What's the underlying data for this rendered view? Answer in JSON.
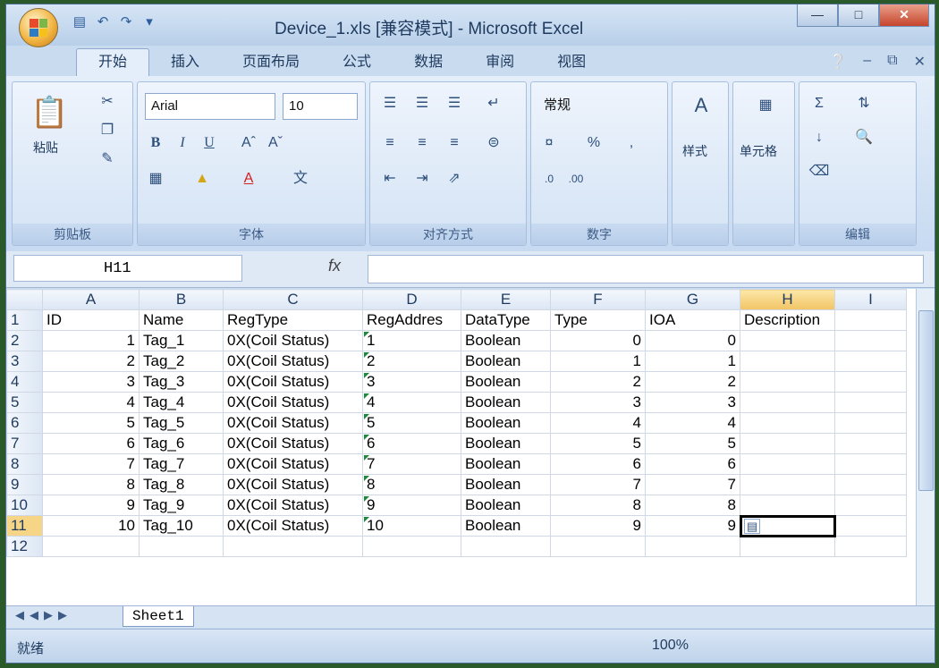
{
  "window": {
    "title": "Device_1.xls  [兼容模式] - Microsoft Excel"
  },
  "tabs": [
    "开始",
    "插入",
    "页面布局",
    "公式",
    "数据",
    "审阅",
    "视图"
  ],
  "ribbon": {
    "clipboard": {
      "label": "剪贴板",
      "paste": "粘贴"
    },
    "font": {
      "label": "字体",
      "name": "Arial",
      "size": "10"
    },
    "alignment": {
      "label": "对齐方式"
    },
    "number": {
      "label": "数字",
      "format": "常规"
    },
    "styles": {
      "label": "样式"
    },
    "cells": {
      "label": "单元格"
    },
    "editing": {
      "label": "编辑"
    }
  },
  "formula_bar": {
    "name_box": "H11",
    "fx": "fx"
  },
  "grid": {
    "columns": [
      "A",
      "B",
      "C",
      "D",
      "E",
      "F",
      "G",
      "H",
      "I"
    ],
    "header_row": [
      "ID",
      "Name",
      "RegType",
      "RegAddres",
      "DataType",
      "Type",
      "IOA",
      "Description",
      ""
    ],
    "rows": [
      [
        "1",
        "Tag_1",
        "0X(Coil Status)",
        "1",
        "Boolean",
        "0",
        "0"
      ],
      [
        "2",
        "Tag_2",
        "0X(Coil Status)",
        "2",
        "Boolean",
        "1",
        "1"
      ],
      [
        "3",
        "Tag_3",
        "0X(Coil Status)",
        "3",
        "Boolean",
        "2",
        "2"
      ],
      [
        "4",
        "Tag_4",
        "0X(Coil Status)",
        "4",
        "Boolean",
        "3",
        "3"
      ],
      [
        "5",
        "Tag_5",
        "0X(Coil Status)",
        "5",
        "Boolean",
        "4",
        "4"
      ],
      [
        "6",
        "Tag_6",
        "0X(Coil Status)",
        "6",
        "Boolean",
        "5",
        "5"
      ],
      [
        "7",
        "Tag_7",
        "0X(Coil Status)",
        "7",
        "Boolean",
        "6",
        "6"
      ],
      [
        "8",
        "Tag_8",
        "0X(Coil Status)",
        "8",
        "Boolean",
        "7",
        "7"
      ],
      [
        "9",
        "Tag_9",
        "0X(Coil Status)",
        "9",
        "Boolean",
        "8",
        "8"
      ],
      [
        "10",
        "Tag_10",
        "0X(Coil Status)",
        "10",
        "Boolean",
        "9",
        "9"
      ]
    ],
    "last_row_num": "12",
    "selected_cell": "H11"
  },
  "sheet": {
    "tab": "Sheet1"
  },
  "status": {
    "ready": "就绪",
    "zoom": "100%"
  }
}
